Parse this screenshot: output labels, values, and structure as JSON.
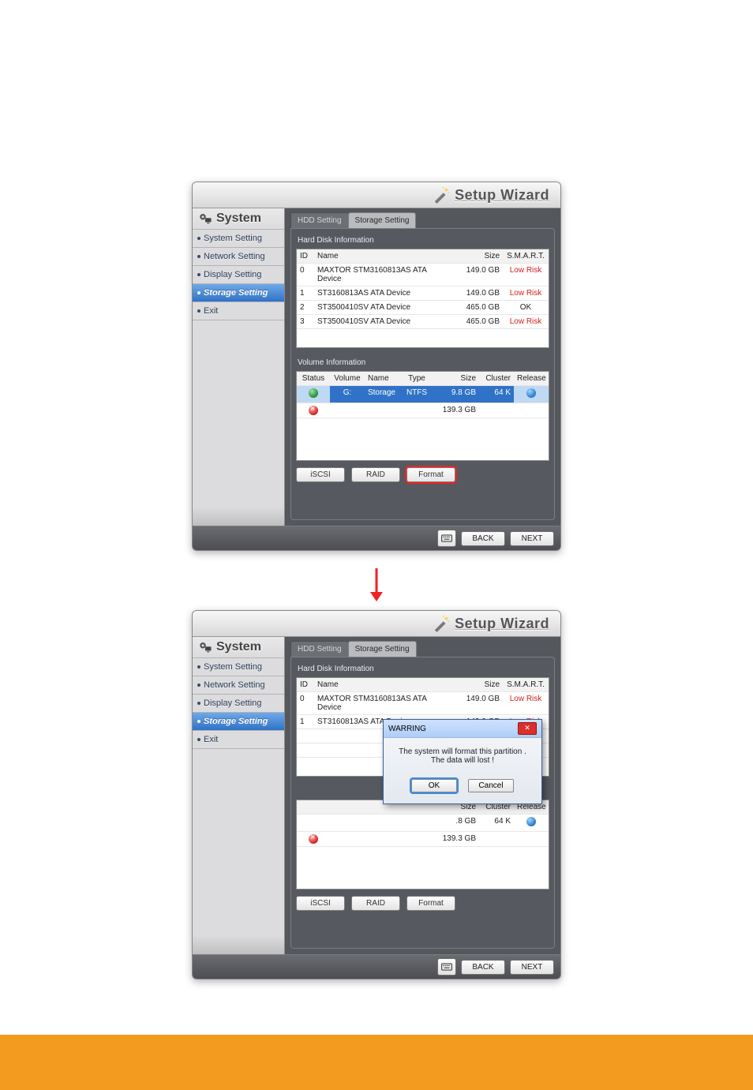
{
  "header": {
    "title": "Setup Wizard"
  },
  "sidebar": {
    "title": "System",
    "items": [
      {
        "label": "System Setting"
      },
      {
        "label": "Network Setting"
      },
      {
        "label": "Display Setting"
      },
      {
        "label": "Storage Setting"
      },
      {
        "label": "Exit"
      }
    ]
  },
  "tabs": {
    "hdd": "HDD Setting",
    "storage": "Storage Setting"
  },
  "hdd_section_title": "Hard Disk Information",
  "vol_section_title": "Volume Information",
  "hdd_cols": {
    "id": "ID",
    "name": "Name",
    "size": "Size",
    "smart": "S.M.A.R.T."
  },
  "hdd_rows": [
    {
      "id": "0",
      "name": "MAXTOR STM3160813AS ATA Device",
      "size": "149.0 GB",
      "smart": "Low Risk",
      "smart_red": true
    },
    {
      "id": "1",
      "name": "ST3160813AS ATA Device",
      "size": "149.0 GB",
      "smart": "Low Risk",
      "smart_red": true
    },
    {
      "id": "2",
      "name": "ST3500410SV ATA Device",
      "size": "465.0 GB",
      "smart": "OK",
      "smart_red": false
    },
    {
      "id": "3",
      "name": "ST3500410SV ATA Device",
      "size": "465.0 GB",
      "smart": "Low Risk",
      "smart_red": true
    }
  ],
  "vol_cols": {
    "status": "Status",
    "volume": "Volume",
    "name": "Name",
    "type": "Type",
    "size": "Size",
    "cluster": "Cluster",
    "release": "Release"
  },
  "vol_rows": [
    {
      "status": "ok",
      "volume": "G:",
      "name": "Storage",
      "type": "NTFS",
      "size": "9.8 GB",
      "cluster": "64 K",
      "release": true,
      "selected": true
    },
    {
      "status": "x",
      "volume": "",
      "name": "",
      "type": "",
      "size": "139.3 GB",
      "cluster": "",
      "release": false,
      "selected": false
    }
  ],
  "buttons": {
    "iscsi": "iSCSI",
    "raid": "RAID",
    "format": "Format"
  },
  "footer": {
    "back": "BACK",
    "next": "NEXT"
  },
  "vol_rows_b": [
    {
      "size": ".8 GB",
      "cluster": "64 K",
      "release": true
    },
    {
      "status": "x",
      "size": "139.3 GB"
    }
  ],
  "dialog": {
    "title": "WARRING",
    "line1": "The system will format this partition .",
    "line2": "The data will lost !",
    "ok": "OK",
    "cancel": "Cancel"
  }
}
